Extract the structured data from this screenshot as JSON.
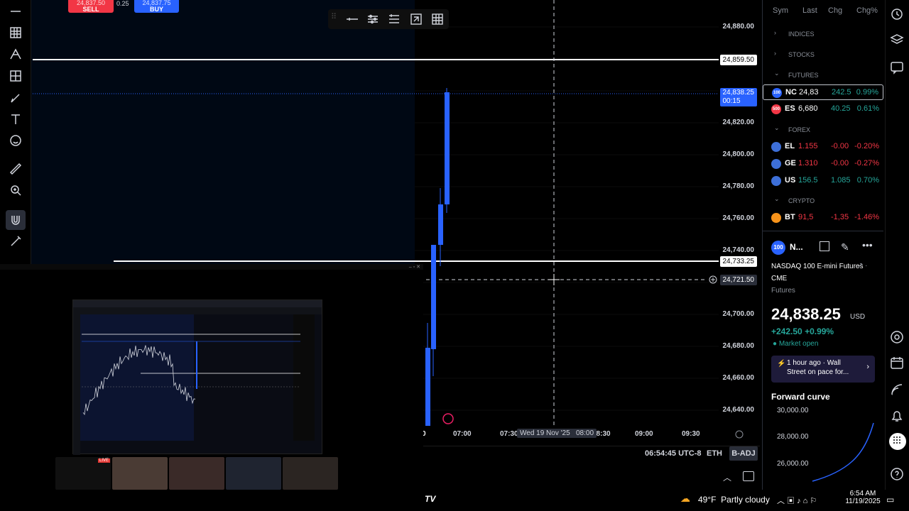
{
  "trade": {
    "sell_price": "24,837.50",
    "sell_label": "SELL",
    "spread": "0.25",
    "buy_price": "24,837.75",
    "buy_label": "BUY"
  },
  "price_axis": {
    "ticks": [
      "24,880.00",
      "24,820.00",
      "24,800.00",
      "24,780.00",
      "24,760.00",
      "24,740.00",
      "24,700.00",
      "24,680.00",
      "24,660.00",
      "24,640.00"
    ],
    "line_upper": "24,859.50",
    "current_price": "24,838.25",
    "countdown": "00:15",
    "line_lower": "24,733.25",
    "crosshair_price": "24,721.50"
  },
  "time_axis": {
    "ticks": [
      "07:00",
      "07:30",
      "08:30",
      "09:00",
      "09:30"
    ],
    "cursor_label": "Wed 19 Nov '25",
    "cursor_time": "08:00"
  },
  "status_bar": {
    "clock": "06:54:45 UTC-8",
    "session": "ETH",
    "adjustment": "B-ADJ"
  },
  "watchlist": {
    "headers": {
      "symbol": "Sym",
      "last": "Last",
      "chg": "Chg",
      "chg_pct": "Chg%"
    },
    "sections": {
      "indices": "INDICES",
      "stocks": "STOCKS",
      "futures": "FUTURES",
      "forex": "FOREX",
      "crypto": "CRYPTO"
    },
    "futures": [
      {
        "icon": "100",
        "symbol": "NC",
        "last": "24,83",
        "chg": "242.5",
        "pct": "0.99%",
        "dir": "up",
        "color": "#2962ff"
      },
      {
        "icon": "500",
        "symbol": "ES",
        "last": "6,680",
        "chg": "40.25",
        "pct": "0.61%",
        "dir": "up",
        "color": "#f23645"
      }
    ],
    "forex": [
      {
        "symbol": "EL",
        "last": "1.155",
        "chg": "-0.00",
        "pct": "-0.20%",
        "dir": "down"
      },
      {
        "symbol": "GE",
        "last": "1.310",
        "chg": "-0.00",
        "pct": "-0.27%",
        "dir": "down"
      },
      {
        "symbol": "US",
        "last": "156.5",
        "chg": "1.085",
        "pct": "0.70%",
        "dir": "up"
      }
    ],
    "crypto": [
      {
        "symbol": "BT",
        "last": "91,5",
        "chg": "-1,35",
        "pct": "-1.46%",
        "dir": "down"
      }
    ]
  },
  "details": {
    "symbol_short": "N...",
    "name": "NASDAQ 100 E-mini Futures",
    "exchange": "CME",
    "type": "Futures",
    "price_main": "24,83",
    "price_tail": "8.25",
    "currency": "USD",
    "change": "+242.50",
    "change_pct": "+0.99%",
    "market_status": "Market open",
    "news_time": "1 hour ago",
    "news_dot": "·",
    "news_source": "Wall",
    "news_headline": "Street on pace for...",
    "forward_curve_title": "Forward curve",
    "curve_ticks": [
      "30,000.00",
      "28,000.00",
      "26,000.00"
    ]
  },
  "taskbar": {
    "weather_temp": "49°F",
    "weather_desc": "Partly cloudy",
    "time": "6:54 AM",
    "date": "11/19/2025"
  },
  "colors": {
    "candle": "#2962ff",
    "up": "#26a69a",
    "down": "#f23645",
    "badge_blue": "#2962ff"
  }
}
